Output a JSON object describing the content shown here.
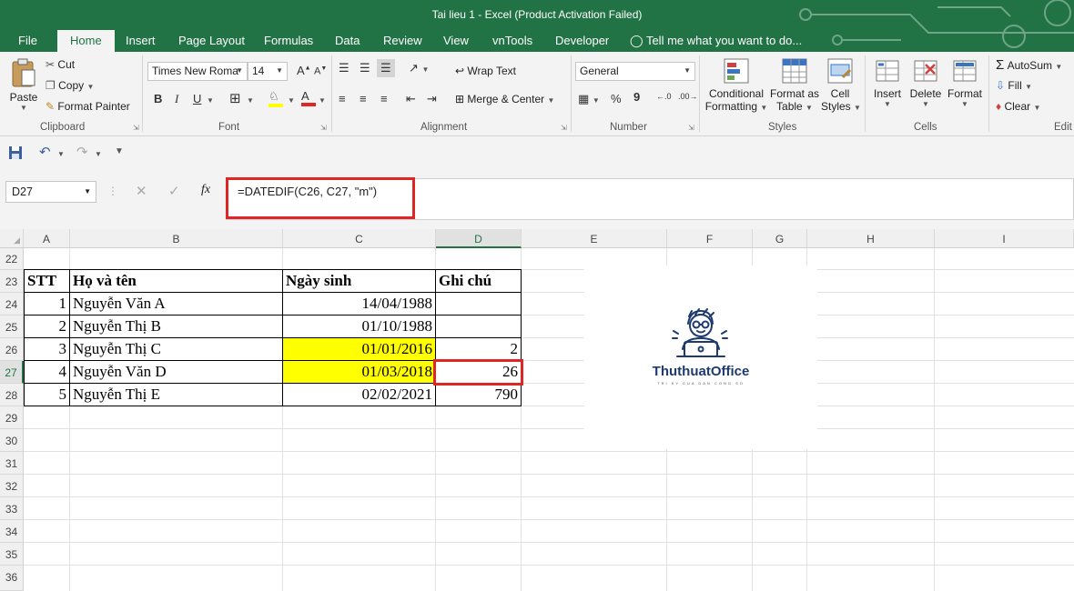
{
  "window": {
    "title": "Tai lieu 1 - Excel (Product Activation Failed)"
  },
  "tabs": [
    "File",
    "Home",
    "Insert",
    "Page Layout",
    "Formulas",
    "Data",
    "Review",
    "View",
    "vnTools",
    "Developer"
  ],
  "active_tab": "Home",
  "tell_me": "Tell me what you want to do...",
  "ribbon": {
    "clipboard": {
      "paste": "Paste",
      "cut": "Cut",
      "copy": "Copy",
      "format_painter": "Format Painter",
      "label": "Clipboard"
    },
    "font": {
      "family": "Times New Roma",
      "size": "14",
      "label": "Font",
      "bold": "B",
      "italic": "I",
      "underline": "U"
    },
    "alignment": {
      "wrap": "Wrap Text",
      "merge": "Merge & Center",
      "label": "Alignment"
    },
    "number": {
      "format": "General",
      "label": "Number",
      "percent": "%",
      "comma": "9"
    },
    "styles": {
      "conditional": [
        "Conditional",
        "Formatting"
      ],
      "format_table": [
        "Format as",
        "Table"
      ],
      "cell_styles": [
        "Cell",
        "Styles"
      ],
      "label": "Styles"
    },
    "cells": {
      "insert": "Insert",
      "delete": "Delete",
      "format": "Format",
      "label": "Cells"
    },
    "editing": {
      "autosum": "AutoSum",
      "fill": "Fill",
      "clear": "Clear",
      "label": "Edit"
    }
  },
  "formula_bar": {
    "name_box": "D27",
    "fx": "fx",
    "formula": "=DATEDIF(C26, C27, \"m\")"
  },
  "columns": [
    "A",
    "B",
    "C",
    "D",
    "E",
    "F",
    "G",
    "H",
    "I"
  ],
  "rows": [
    "22",
    "23",
    "24",
    "25",
    "26",
    "27",
    "28",
    "29",
    "30",
    "31",
    "32",
    "33",
    "34",
    "35",
    "36"
  ],
  "table": {
    "headers": [
      "STT",
      "Họ và tên",
      "Ngày sinh",
      "Ghi chú"
    ],
    "rows": [
      [
        "1",
        "Nguyễn Văn A",
        "14/04/1988",
        ""
      ],
      [
        "2",
        "Nguyễn Thị B",
        "01/10/1988",
        ""
      ],
      [
        "3",
        "Nguyễn Thị C",
        "01/01/2016",
        "2"
      ],
      [
        "4",
        "Nguyễn Văn D",
        "01/03/2018",
        "26"
      ],
      [
        "5",
        "Nguyễn Thị E",
        "02/02/2021",
        "790"
      ]
    ]
  },
  "logo": {
    "brand": "ThuthuatOffice",
    "tagline": "TRI KY CUA DAN CONG SO"
  },
  "colors": {
    "excel_green": "#217346",
    "highlight": "#ffff00",
    "annotation_red": "#e02525"
  }
}
